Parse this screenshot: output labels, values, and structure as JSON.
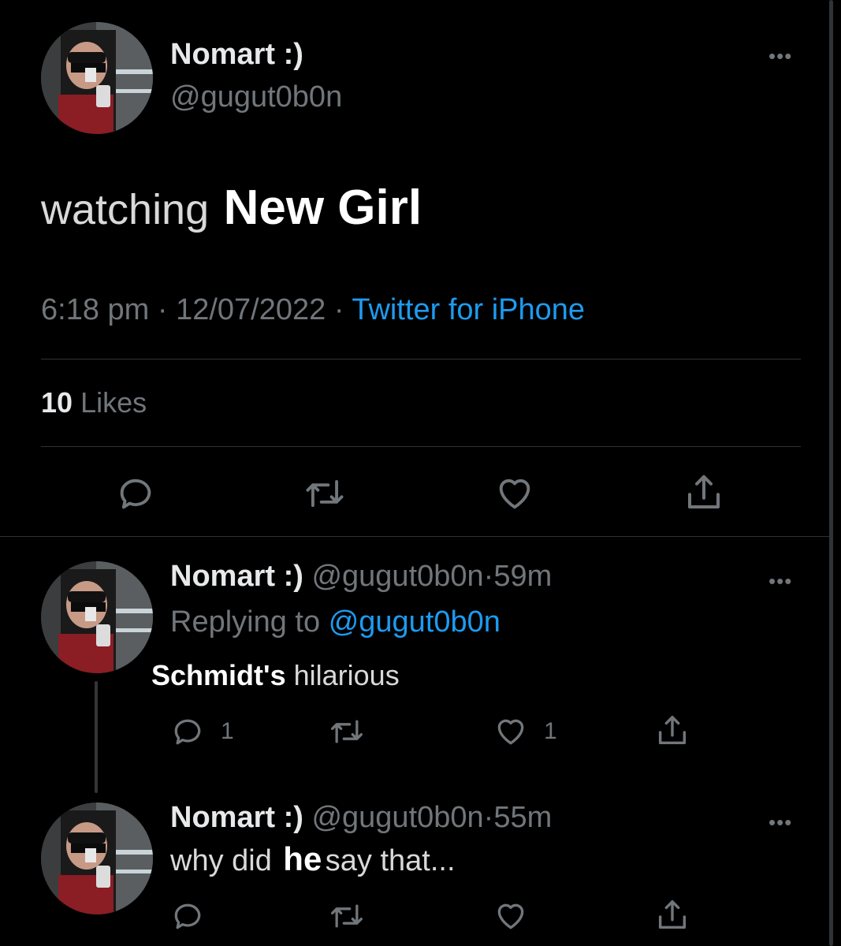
{
  "main_tweet": {
    "author_name": "Nomart :)",
    "author_handle": "@gugut0b0n",
    "text_prefix": "watching",
    "text_highlight": "New Girl",
    "time": "6:18 pm",
    "date": "12/07/2022",
    "sep": "·",
    "source": "Twitter for iPhone",
    "likes_count": "10",
    "likes_label": "Likes"
  },
  "replies": [
    {
      "author_name": "Nomart :)",
      "author_handle": "@gugut0b0n",
      "sep": "·",
      "age": "59m",
      "replying_label": "Replying to",
      "replying_handle": "@gugut0b0n",
      "text_bold": "Schmidt's",
      "text_rest": "hilarious",
      "reply_count": "1",
      "like_count": "1"
    },
    {
      "author_name": "Nomart :)",
      "author_handle": "@gugut0b0n",
      "sep": "·",
      "age": "55m",
      "text_prefix": "why did",
      "text_bold": "he",
      "text_rest": "say that..."
    }
  ],
  "more_glyph": "•••",
  "colors": {
    "background": "#000000",
    "link": "#1d9bf0",
    "muted": "#71767b",
    "divider": "#2f3336"
  }
}
